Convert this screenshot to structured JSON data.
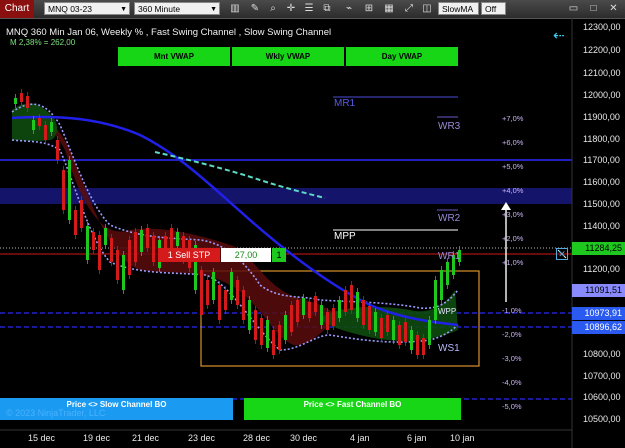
{
  "toolbar": {
    "title": "Chart",
    "instrument": "MNQ 03-23",
    "period": "360 Minute",
    "indicator_select": "SlowMA",
    "toggle": "Off",
    "icons": [
      "bar-style-icon",
      "pencil-icon",
      "magnify-icon",
      "crosshair-icon",
      "properties-icon",
      "strategy-icon",
      "indicator-icon",
      "chart-trader-icon",
      "grid-icon",
      "zoom-icon"
    ]
  },
  "header": {
    "title": "MNQ 360 Min Jan 06, Weekly % , Fast Swing Channel , Slow Swing Channel",
    "sub": "M 2,38% = 262,00"
  },
  "vwap_buttons": [
    "Mnt VWAP",
    "Wkly VWAP",
    "Day VWAP"
  ],
  "bottom_buttons": {
    "slow": "Price <> Slow Channel BO",
    "fast": "Price <> Fast Channel BO"
  },
  "copyright": "© 2023 NinjaTrader, LLC",
  "levels": {
    "mr1": "MR1",
    "wr3": "WR3",
    "wr2": "WR2",
    "mpp": "MPP",
    "wr1": "WR1",
    "wpp": "WPP",
    "ws1": "WS1"
  },
  "percent_labels": [
    "+7,0%",
    "+6,0%",
    "+5,0%",
    "+4,0%",
    "+3,0%",
    "+2,0%",
    "+1,0%",
    "-1,0%",
    "-2,0%",
    "-3,0%",
    "-4,0%",
    "-5,0%"
  ],
  "y_axis": [
    "12300,00",
    "12200,00",
    "12100,00",
    "12000,00",
    "11900,00",
    "11800,00",
    "11700,00",
    "11600,00",
    "11500,00",
    "11400,00",
    "11200,00",
    "10800,00",
    "10700,00",
    "10600,00",
    "10500,00"
  ],
  "x_axis": [
    "15 dec",
    "19 dec",
    "21 dec",
    "23 dec",
    "28 dec",
    "30 dec",
    "4 jan",
    "6 jan",
    "10 jan"
  ],
  "price_tags": {
    "last": "11284,25",
    "t1": "11091,51",
    "t2": "10973,91",
    "t3": "10896,62"
  },
  "order": {
    "label": "1 Sell STP",
    "price": "27,00",
    "qty": "1"
  },
  "colors": {
    "accent": "#16d616",
    "up": "#1ec81e",
    "down": "#d41a1a",
    "channel": "#2a2ae0",
    "level": "#6060ff"
  }
}
